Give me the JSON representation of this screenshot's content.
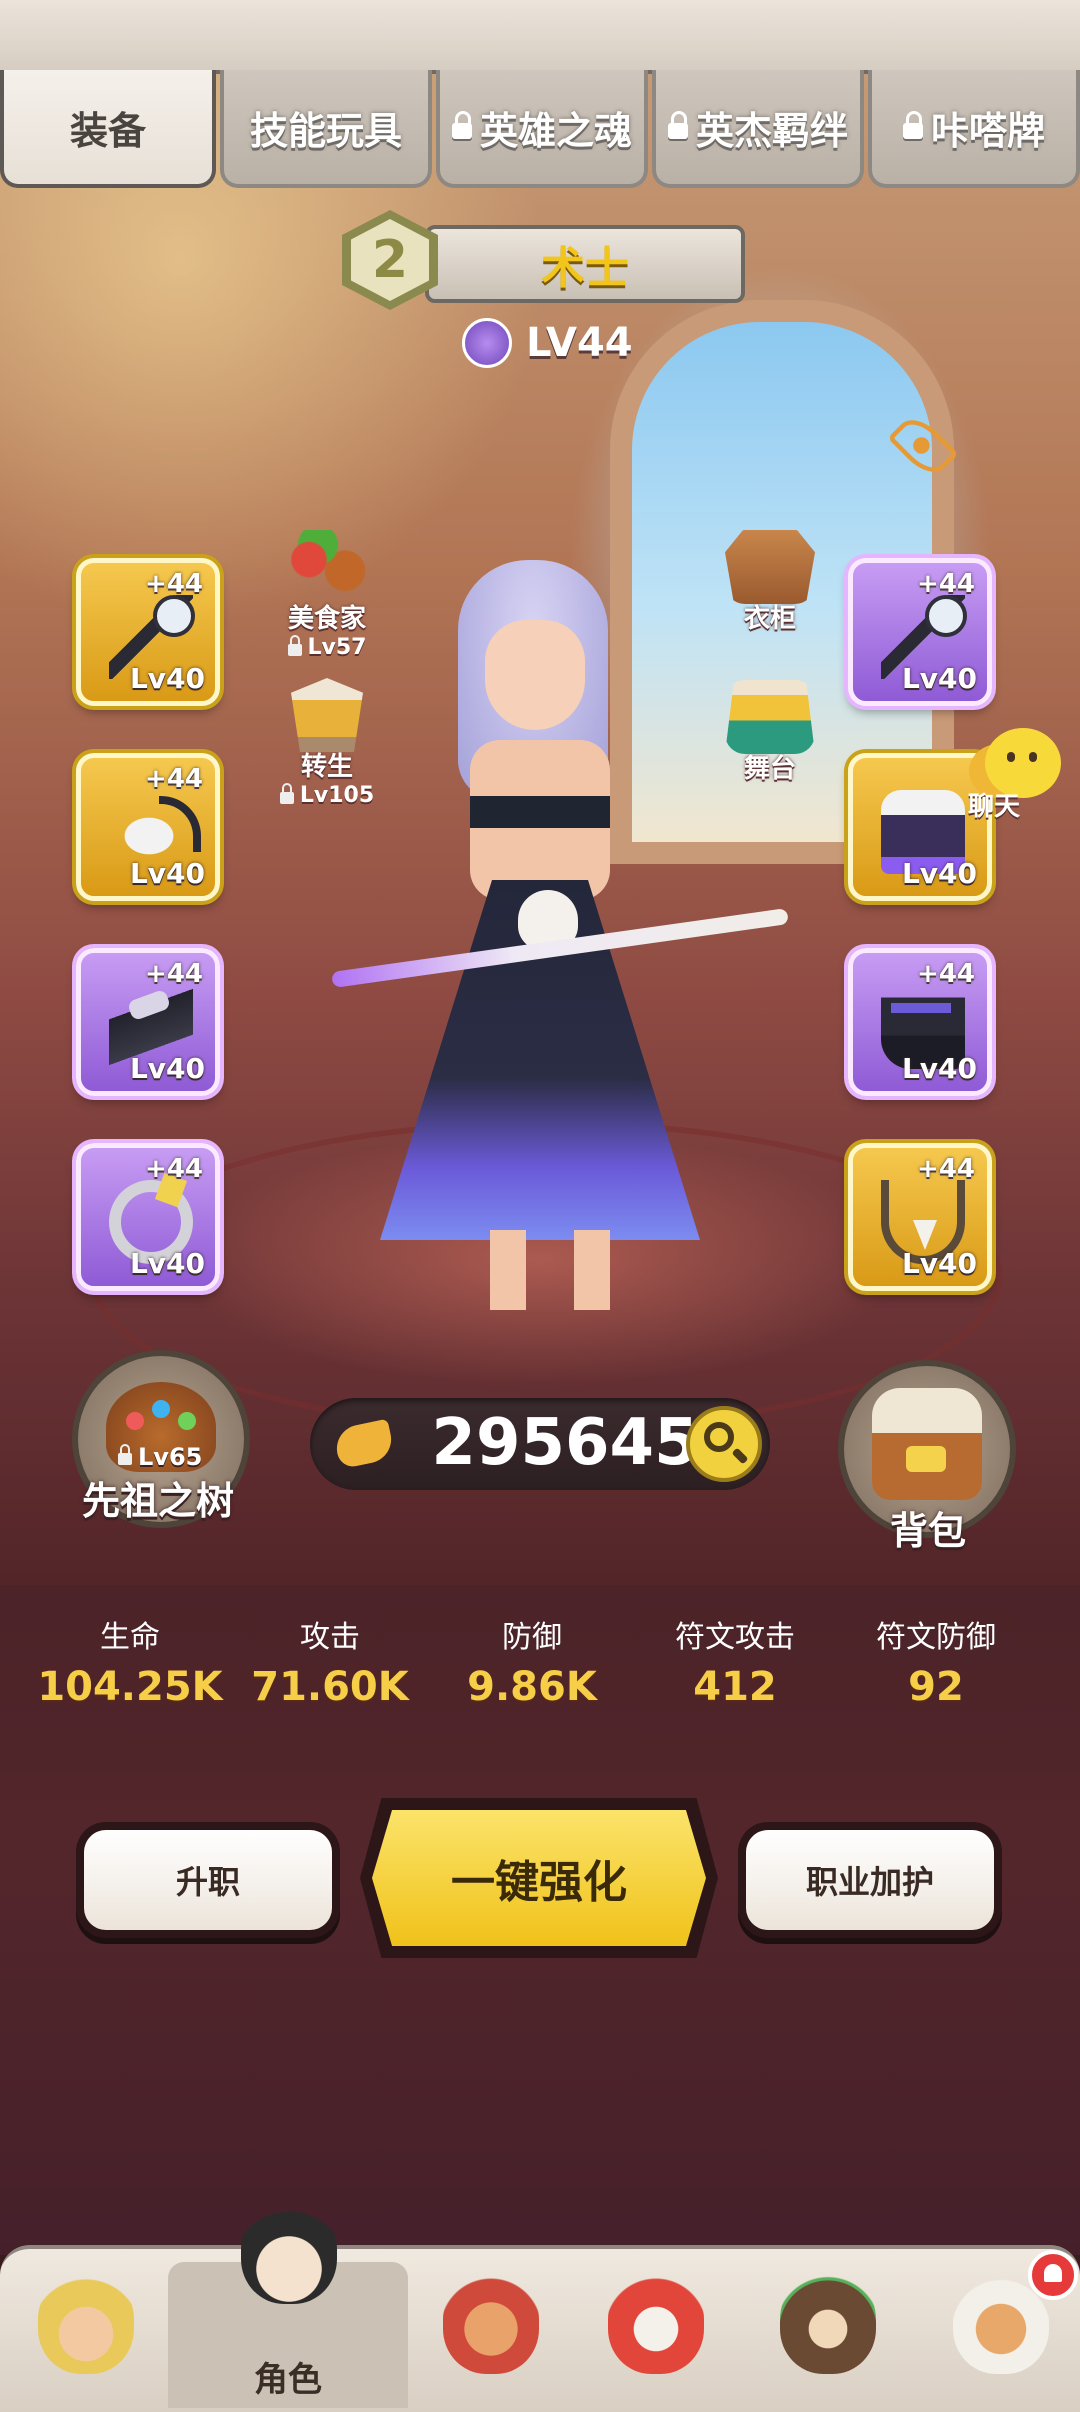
{
  "tabs": [
    {
      "label": "装备",
      "locked": false,
      "active": true
    },
    {
      "label": "技能玩具",
      "locked": false,
      "active": false
    },
    {
      "label": "英雄之魂",
      "locked": true,
      "active": false
    },
    {
      "label": "英杰羁绊",
      "locked": true,
      "active": false
    },
    {
      "label": "咔嗒牌",
      "locked": true,
      "active": false
    }
  ],
  "hero": {
    "rank": "2",
    "class_name": "术士",
    "level": "LV44"
  },
  "equipment": {
    "left": [
      {
        "name": "weapon",
        "plus": "+44",
        "level": "Lv40",
        "rarity": "gold",
        "icon": "staff-icon"
      },
      {
        "name": "helmet",
        "plus": "+44",
        "level": "Lv40",
        "rarity": "gold",
        "icon": "skull-helm-icon"
      },
      {
        "name": "gloves",
        "plus": "+44",
        "level": "Lv40",
        "rarity": "purple",
        "icon": "glove-icon"
      },
      {
        "name": "ring",
        "plus": "+44",
        "level": "Lv40",
        "rarity": "purple",
        "icon": "ring-icon"
      }
    ],
    "right": [
      {
        "name": "offhand",
        "plus": "+44",
        "level": "Lv40",
        "rarity": "purple",
        "icon": "bone-staff-icon"
      },
      {
        "name": "armor",
        "plus": "",
        "level": "Lv40",
        "rarity": "gold",
        "icon": "robe-icon"
      },
      {
        "name": "boots",
        "plus": "+44",
        "level": "Lv40",
        "rarity": "purple",
        "icon": "boot-icon"
      },
      {
        "name": "necklace",
        "plus": "+44",
        "level": "Lv40",
        "rarity": "gold",
        "icon": "necklace-icon"
      }
    ]
  },
  "features": {
    "gourmet": {
      "label": "美食家",
      "lock_level": "Lv57"
    },
    "rebirth": {
      "label": "转生",
      "lock_level": "Lv105"
    },
    "wardrobe": {
      "label": "衣柜"
    },
    "stage": {
      "label": "舞台"
    },
    "chat": {
      "label": "聊天"
    }
  },
  "ancestor_tree": {
    "label": "先祖之树",
    "lock_level": "Lv65"
  },
  "backpack": {
    "label": "背包"
  },
  "power": {
    "value": "295645"
  },
  "stats": [
    {
      "label": "生命",
      "value": "104.25K"
    },
    {
      "label": "攻击",
      "value": "71.60K"
    },
    {
      "label": "防御",
      "value": "9.86K"
    },
    {
      "label": "符文攻击",
      "value": "412"
    },
    {
      "label": "符文防御",
      "value": "92"
    }
  ],
  "actions": {
    "promote": "升职",
    "upgrade_all": "一键强化",
    "class_guard": "职业加护"
  },
  "bottom_nav": {
    "active_label": "角色"
  },
  "colors": {
    "gold_slot": "#f0b52a",
    "purple_slot": "#a874e6",
    "class_name": "#f1c51a",
    "stat_value": "#f6ce47",
    "main_button": "#f6d33a"
  }
}
